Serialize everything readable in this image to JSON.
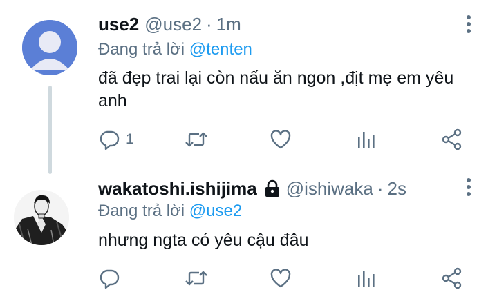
{
  "tweets": [
    {
      "display_name": "use2",
      "handle": "@use2",
      "separator": "·",
      "time": "1m",
      "reply_prefix": "Đang trả lời",
      "reply_to": "@tenten",
      "text": "đã đẹp trai lại còn nấu ăn ngon ,địt mẹ em yêu anh",
      "reply_count": "1",
      "avatar": "default-avatar",
      "protected": false
    },
    {
      "display_name": "wakatoshi.ishijima",
      "handle": "@ishiwaka",
      "separator": "·",
      "time": "2s",
      "reply_prefix": "Đang trả lời",
      "reply_to": "@use2",
      "text": "nhưng ngta có yêu cậu đâu",
      "reply_count": "",
      "avatar": "manga-character-avatar",
      "protected": true
    }
  ],
  "icons": [
    "reply-icon",
    "retweet-icon",
    "like-icon",
    "stats-icon",
    "share-icon",
    "more-icon",
    "lock-icon"
  ],
  "colors": {
    "text": "#0f1419",
    "secondary": "#5b7083",
    "link": "#1d9bf0",
    "thread_line": "#cfd9de",
    "default_avatar_bg": "#5b7fd6"
  }
}
